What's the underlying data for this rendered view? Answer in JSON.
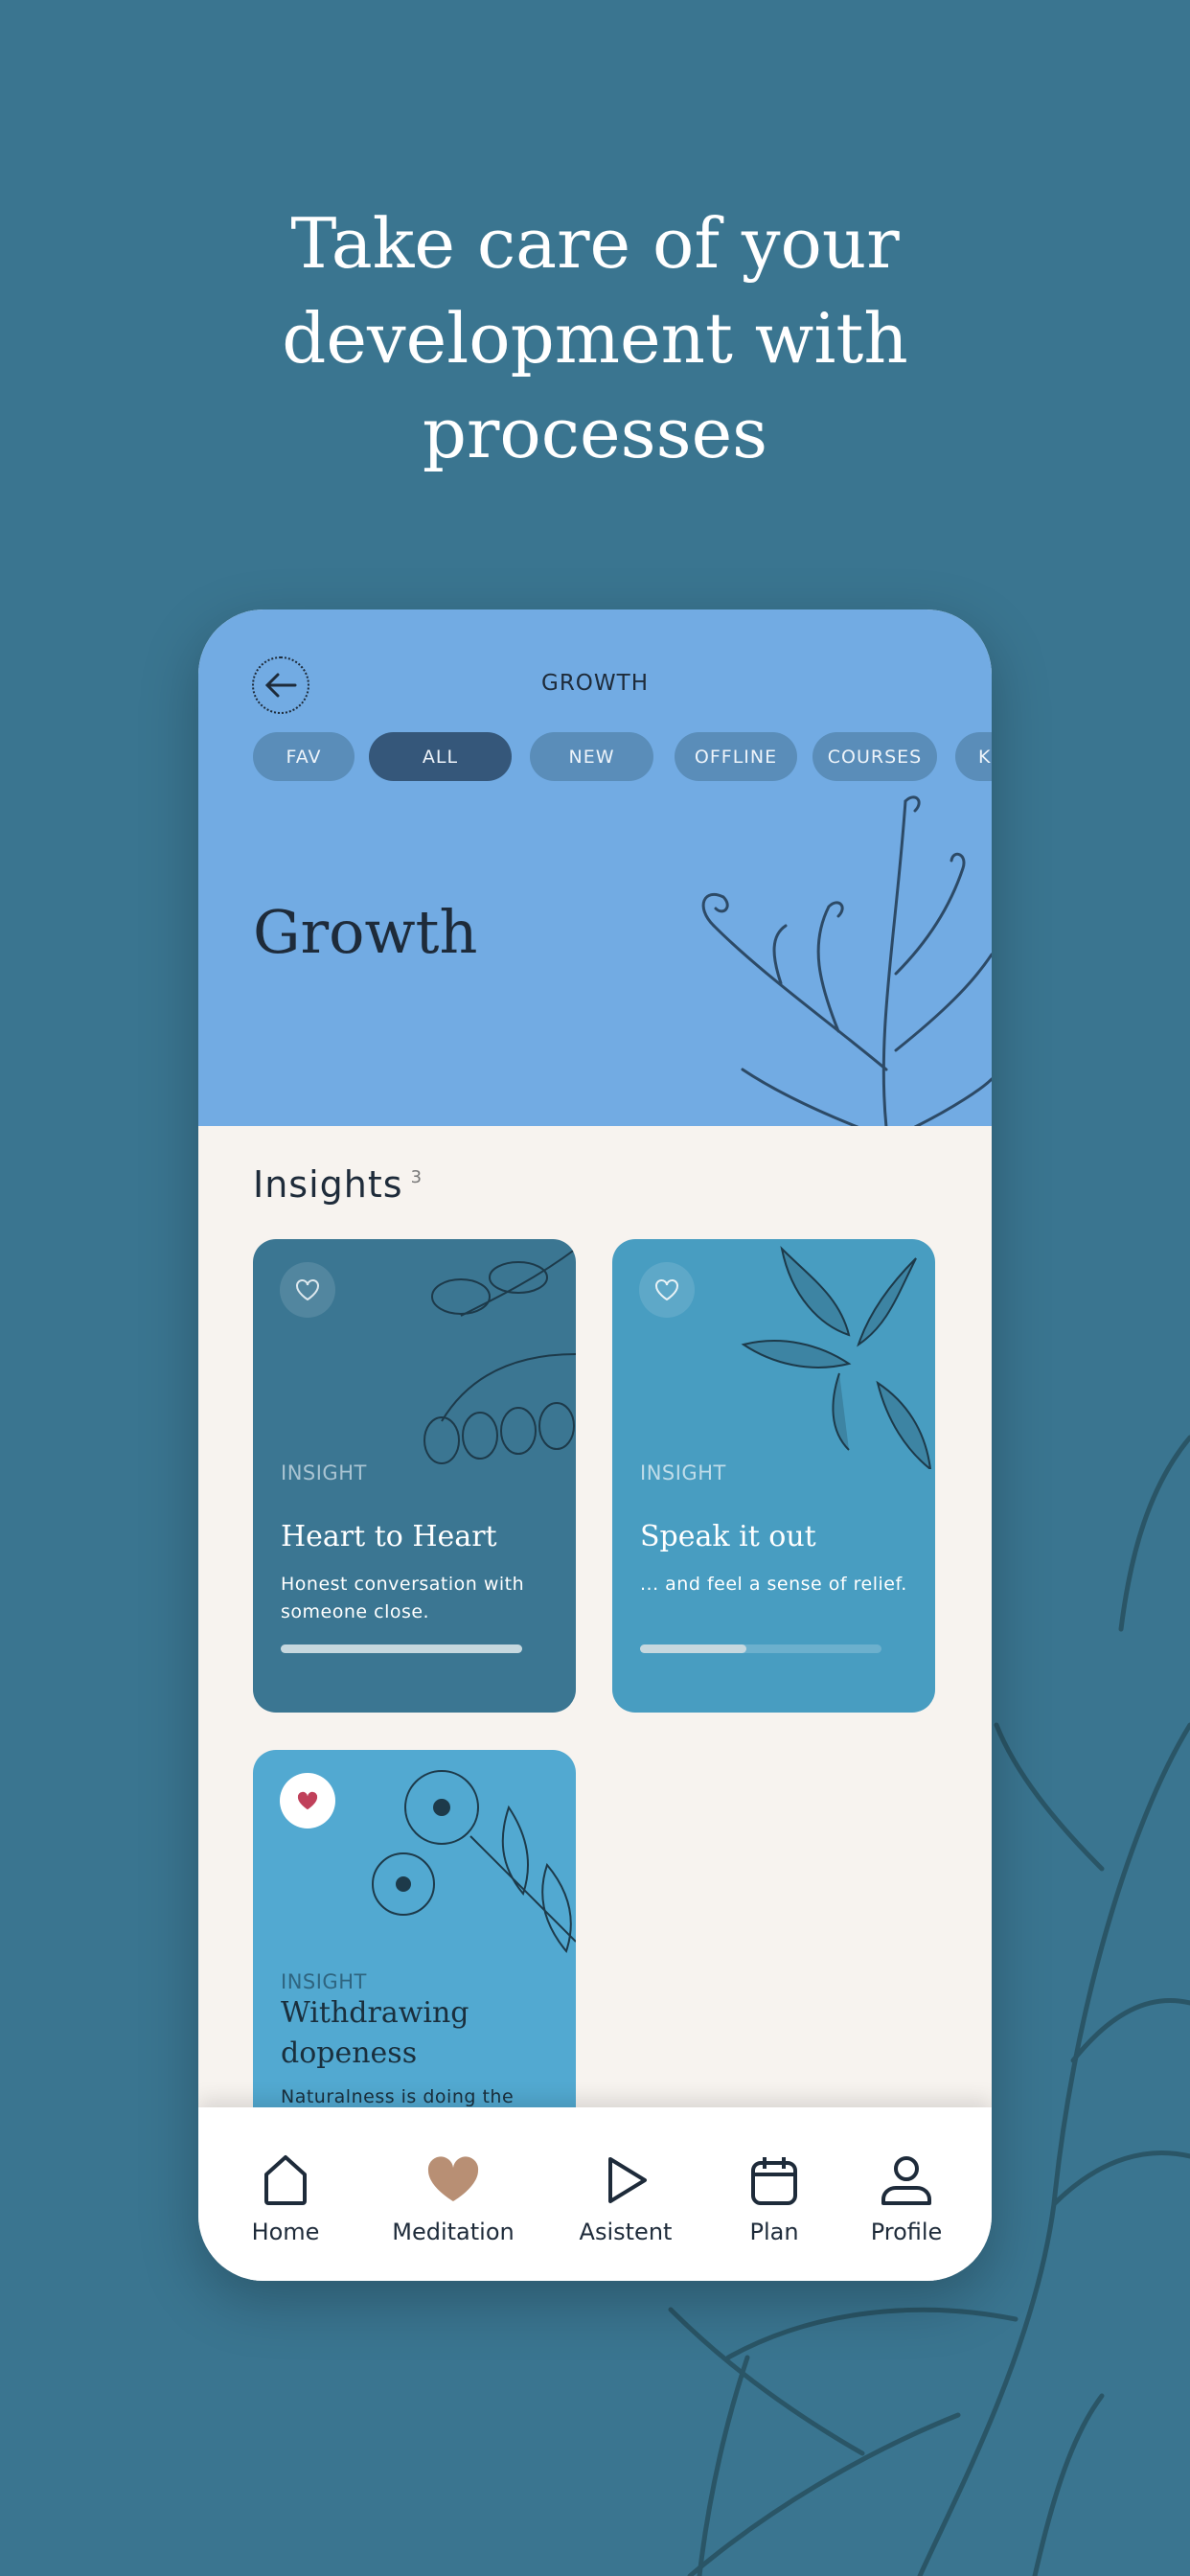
{
  "hero": {
    "lines": [
      "Take care of your",
      "development with",
      "processes"
    ]
  },
  "app": {
    "header": {
      "title": "GROWTH",
      "back_icon": "arrow-left-icon",
      "heading": "Growth",
      "color": "#72abe3"
    },
    "chips": [
      {
        "label": "FAV"
      },
      {
        "label": "ALL",
        "active": true
      },
      {
        "label": "NEW"
      },
      {
        "label": "OFFLINE"
      },
      {
        "label": "COURSES"
      },
      {
        "label": "K"
      }
    ],
    "section": {
      "title": "Insights",
      "count": "3"
    },
    "cards": [
      {
        "label": "INSIGHT",
        "title": "Heart to Heart",
        "desc": "Honest conversation with someone close.",
        "progress": 1.0,
        "favorite": false,
        "color": "#3b7692"
      },
      {
        "label": "INSIGHT",
        "title": "Speak it out",
        "desc": "... and feel a sense of relief.",
        "progress": 0.44,
        "favorite": false,
        "color": "#489dc1"
      },
      {
        "label": "INSIGHT",
        "title": "Withdrawing dopeness",
        "desc": "Naturalness is doing the",
        "favorite": true,
        "color": "#52a9d1"
      }
    ],
    "nav": [
      {
        "label": "Home",
        "icon": "home-icon"
      },
      {
        "label": "Meditation",
        "icon": "heart-icon",
        "active": true
      },
      {
        "label": "Asistent",
        "icon": "play-icon"
      },
      {
        "label": "Plan",
        "icon": "calendar-icon"
      },
      {
        "label": "Profile",
        "icon": "profile-icon"
      }
    ]
  }
}
